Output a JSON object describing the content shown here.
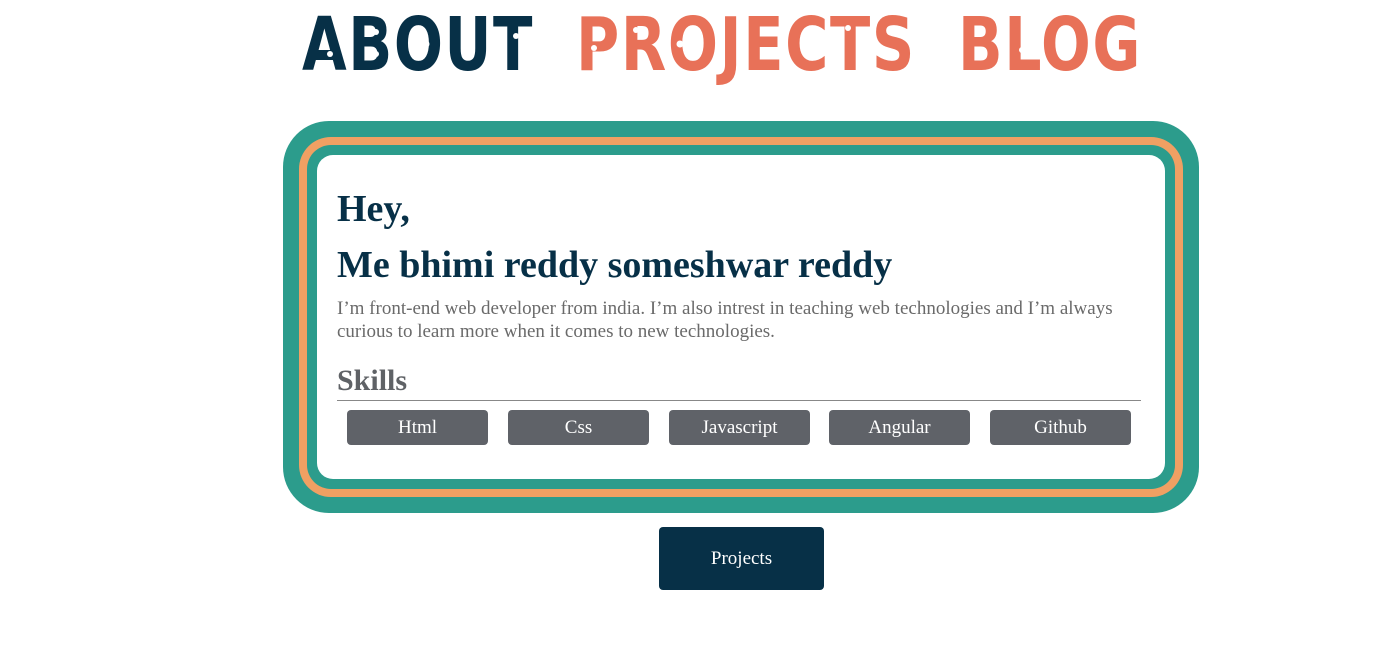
{
  "nav": {
    "about_label": "ABOUT",
    "projects_label": "PROJECTS",
    "blog_label": "BLOG"
  },
  "about": {
    "greeting": "Hey,",
    "name": "Me bhimi reddy someshwar reddy",
    "bio": "I’m front-end web developer from india. I’m also intrest in teaching web technologies and I’m always curious to learn more when it comes to new technologies.",
    "skills_heading": "Skills",
    "skills": [
      "Html",
      "Css",
      "Javascript",
      "Angular",
      "Github"
    ]
  },
  "projects_button_label": "Projects",
  "colors": {
    "navy": "#073047",
    "coral": "#e87158",
    "teal": "#2c9c8c",
    "orange": "#f0a063",
    "badge_gray": "#5f6268"
  }
}
